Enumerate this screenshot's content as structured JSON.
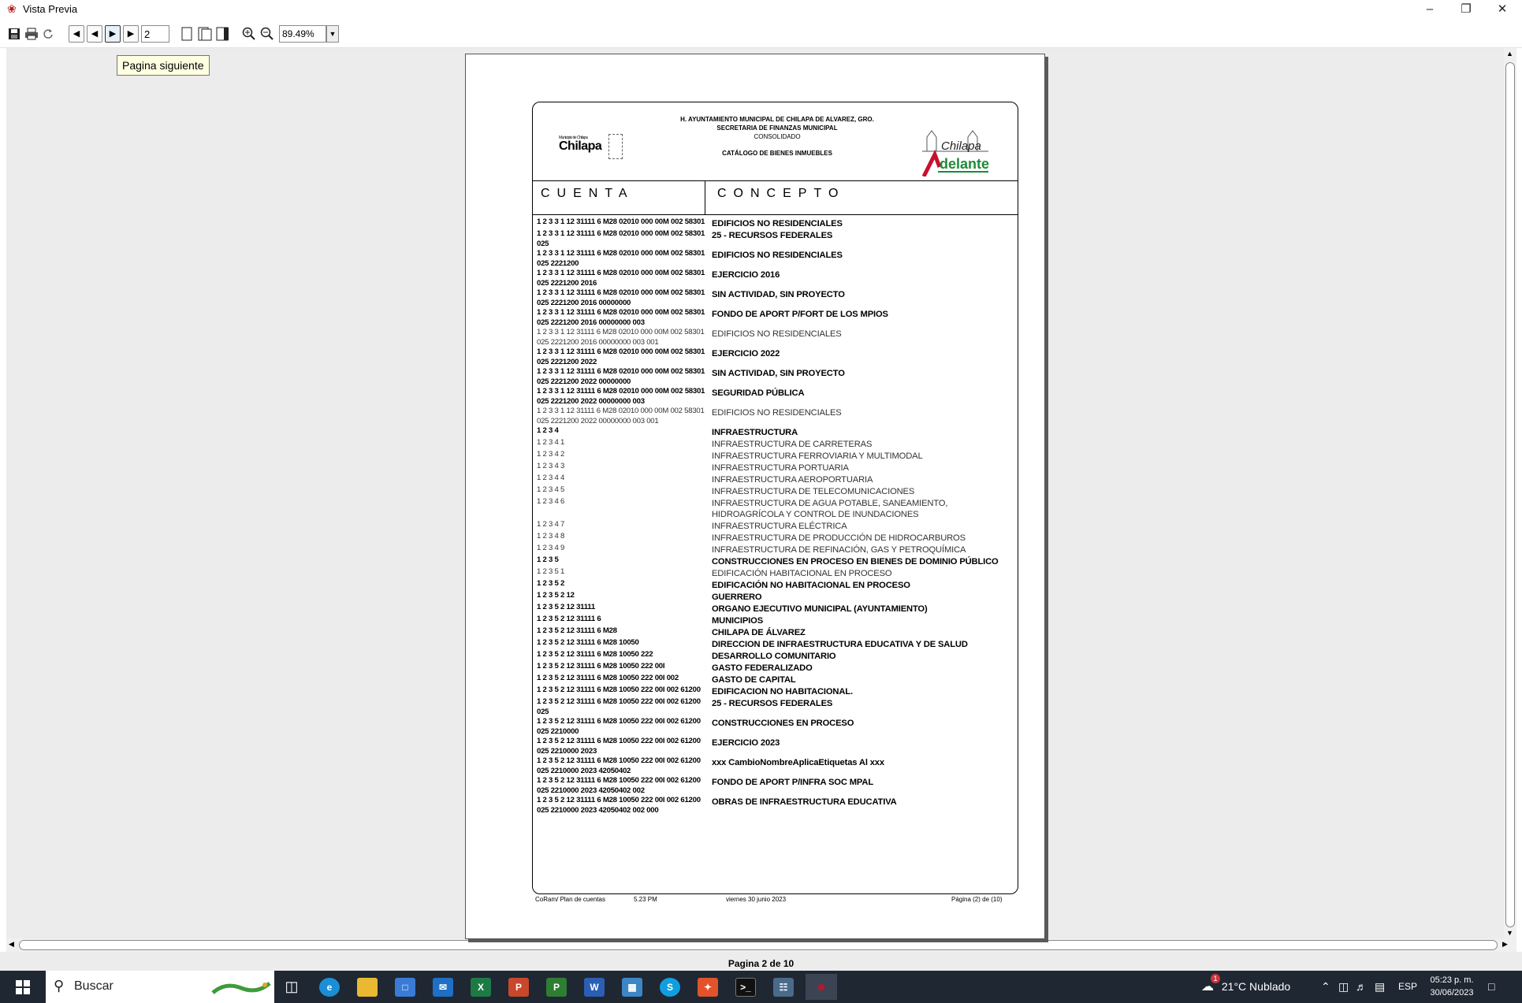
{
  "window": {
    "title": "Vista Previa",
    "minimize": "–",
    "restore": "❐",
    "close": "✕"
  },
  "toolbar": {
    "page_value": "2",
    "zoom_value": "89.49%",
    "tooltip": "Pagina siguiente",
    "icons": [
      "save-icon",
      "print-icon",
      "refresh-icon",
      "first-page-icon",
      "previous-page-icon",
      "next-page-icon",
      "last-page-icon",
      "single-page-icon",
      "two-page-icon",
      "multi-page-icon",
      "zoom-in-icon",
      "zoom-out-icon"
    ]
  },
  "status": {
    "page_of": "Pagina 2 de 10"
  },
  "report": {
    "org": "H. AYUNTAMIENTO MUNICIPAL DE CHILAPA DE ALVAREZ, GRO.",
    "dept": "SECRETARIA DE FINANZAS MUNICIPAL",
    "scope": "CONSOLIDADO",
    "title": "CATÁLOGO DE BIENES INMUEBLES",
    "logo_left": "Chilapa",
    "logo_left_small": "Municipio de Chilapa",
    "logo_right_top": "Chilapa",
    "logo_right_bottom": "delante",
    "col_cuenta": "CUENTA",
    "col_concepto": "CONCEPTO",
    "rows": [
      {
        "cuenta": "1 2 3 3 1 12 31111 6 M28 02010 000 00M 002 58301",
        "concepto": "EDIFICIOS NO RESIDENCIALES",
        "bold": true
      },
      {
        "cuenta": "1 2 3 3 1 12 31111 6 M28 02010 000 00M 002 58301 025",
        "concepto": "25 - RECURSOS FEDERALES",
        "bold": true
      },
      {
        "cuenta": "1 2 3 3 1 12 31111 6 M28 02010 000 00M 002 58301 025 2221200",
        "concepto": "EDIFICIOS NO RESIDENCIALES",
        "bold": true
      },
      {
        "cuenta": "1 2 3 3 1 12 31111 6 M28 02010 000 00M 002 58301 025 2221200 2016",
        "concepto": "EJERCICIO 2016",
        "bold": true
      },
      {
        "cuenta": "1 2 3 3 1 12 31111 6 M28 02010 000 00M 002 58301 025 2221200 2016 00000000",
        "concepto": "SIN ACTIVIDAD, SIN PROYECTO",
        "bold": true
      },
      {
        "cuenta": "1 2 3 3 1 12 31111 6 M28 02010 000 00M 002 58301 025 2221200 2016 00000000 003",
        "concepto": "FONDO DE APORT P/FORT DE LOS MPIOS",
        "bold": true
      },
      {
        "cuenta": "1 2 3 3 1 12 31111 6 M28 02010 000 00M 002 58301 025 2221200 2016 00000000 003 001",
        "concepto": "EDIFICIOS NO RESIDENCIALES",
        "bold": false
      },
      {
        "cuenta": "1 2 3 3 1 12 31111 6 M28 02010 000 00M 002 58301 025 2221200 2022",
        "concepto": "EJERCICIO 2022",
        "bold": true
      },
      {
        "cuenta": "1 2 3 3 1 12 31111 6 M28 02010 000 00M 002 58301 025 2221200 2022 00000000",
        "concepto": "SIN ACTIVIDAD, SIN PROYECTO",
        "bold": true
      },
      {
        "cuenta": "1 2 3 3 1 12 31111 6 M28 02010 000 00M 002 58301 025 2221200 2022 00000000 003",
        "concepto": "SEGURIDAD PÚBLICA",
        "bold": true
      },
      {
        "cuenta": "1 2 3 3 1 12 31111 6 M28 02010 000 00M 002 58301 025 2221200 2022 00000000 003 001",
        "concepto": "EDIFICIOS NO RESIDENCIALES",
        "bold": false
      },
      {
        "cuenta": "1 2 3 4",
        "concepto": "INFRAESTRUCTURA",
        "bold": true
      },
      {
        "cuenta": "1 2 3 4 1",
        "concepto": "INFRAESTRUCTURA DE CARRETERAS",
        "bold": false
      },
      {
        "cuenta": "1 2 3 4 2",
        "concepto": "INFRAESTRUCTURA FERROVIARIA Y MULTIMODAL",
        "bold": false
      },
      {
        "cuenta": "1 2 3 4 3",
        "concepto": "INFRAESTRUCTURA PORTUARIA",
        "bold": false
      },
      {
        "cuenta": "1 2 3 4 4",
        "concepto": "INFRAESTRUCTURA AEROPORTUARIA",
        "bold": false
      },
      {
        "cuenta": "1 2 3 4 5",
        "concepto": "INFRAESTRUCTURA DE TELECOMUNICACIONES",
        "bold": false
      },
      {
        "cuenta": "1 2 3 4 6",
        "concepto": "INFRAESTRUCTURA DE AGUA POTABLE, SANEAMIENTO, HIDROAGRÍCOLA Y CONTROL DE INUNDACIONES",
        "bold": false
      },
      {
        "cuenta": "1 2 3 4 7",
        "concepto": "INFRAESTRUCTURA ELÉCTRICA",
        "bold": false
      },
      {
        "cuenta": "1 2 3 4 8",
        "concepto": "INFRAESTRUCTURA DE PRODUCCIÓN DE HIDROCARBUROS",
        "bold": false
      },
      {
        "cuenta": "1 2 3 4 9",
        "concepto": "INFRAESTRUCTURA DE REFINACIÓN, GAS Y PETROQUÍMICA",
        "bold": false
      },
      {
        "cuenta": "1 2 3 5",
        "concepto": "CONSTRUCCIONES EN PROCESO EN BIENES DE DOMINIO PÚBLICO",
        "bold": true
      },
      {
        "cuenta": "1 2 3 5 1",
        "concepto": "EDIFICACIÓN HABITACIONAL EN PROCESO",
        "bold": false
      },
      {
        "cuenta": "1 2 3 5 2",
        "concepto": "EDIFICACIÓN NO HABITACIONAL EN PROCESO",
        "bold": true
      },
      {
        "cuenta": "1 2 3 5 2 12",
        "concepto": "GUERRERO",
        "bold": true
      },
      {
        "cuenta": "1 2 3 5 2 12 31111",
        "concepto": "ORGANO EJECUTIVO MUNICIPAL (AYUNTAMIENTO)",
        "bold": true
      },
      {
        "cuenta": "1 2 3 5 2 12 31111 6",
        "concepto": "MUNICIPIOS",
        "bold": true
      },
      {
        "cuenta": "1 2 3 5 2 12 31111 6 M28",
        "concepto": "CHILAPA DE ÁLVAREZ",
        "bold": true
      },
      {
        "cuenta": "1 2 3 5 2 12 31111 6 M28 10050",
        "concepto": "DIRECCION DE INFRAESTRUCTURA EDUCATIVA Y DE SALUD",
        "bold": true
      },
      {
        "cuenta": "1 2 3 5 2 12 31111 6 M28 10050 222",
        "concepto": "DESARROLLO COMUNITARIO",
        "bold": true
      },
      {
        "cuenta": "1 2 3 5 2 12 31111 6 M28 10050 222 00I",
        "concepto": "GASTO FEDERALIZADO",
        "bold": true
      },
      {
        "cuenta": "1 2 3 5 2 12 31111 6 M28 10050 222 00I 002",
        "concepto": "GASTO DE CAPITAL",
        "bold": true
      },
      {
        "cuenta": "1 2 3 5 2 12 31111 6 M28 10050 222 00I 002 61200",
        "concepto": "EDIFICACION NO HABITACIONAL.",
        "bold": true
      },
      {
        "cuenta": "1 2 3 5 2 12 31111 6 M28 10050 222 00I 002 61200 025",
        "concepto": "25 - RECURSOS FEDERALES",
        "bold": true
      },
      {
        "cuenta": "1 2 3 5 2 12 31111 6 M28 10050 222 00I 002 61200 025 2210000",
        "concepto": "CONSTRUCCIONES EN PROCESO",
        "bold": true
      },
      {
        "cuenta": "1 2 3 5 2 12 31111 6 M28 10050 222 00I 002 61200 025 2210000 2023",
        "concepto": "EJERCICIO 2023",
        "bold": true
      },
      {
        "cuenta": "1 2 3 5 2 12 31111 6 M28 10050 222 00I 002 61200 025 2210000 2023 42050402",
        "concepto": "xxx CambioNombreAplicaEtiquetas Al xxx",
        "bold": true
      },
      {
        "cuenta": "1 2 3 5 2 12 31111 6 M28 10050 222 00I 002 61200 025 2210000 2023 42050402 002",
        "concepto": "FONDO DE APORT P/INFRA SOC MPAL",
        "bold": true
      },
      {
        "cuenta": "1 2 3 5 2 12 31111 6 M28 10050 222 00I 002 61200 025 2210000 2023 42050402 002 000",
        "concepto": "OBRAS DE INFRAESTRUCTURA EDUCATIVA",
        "bold": true
      }
    ],
    "footer": {
      "source": "CoRam/ Plan de cuentas",
      "time": "5.23 PM",
      "date": "viernes 30 junio 2023",
      "page": "Página (2) de (10)"
    }
  },
  "taskbar": {
    "search_placeholder": "Buscar",
    "weather": "21°C  Nublado",
    "lang": "ESP",
    "time": "05:23 p. m.",
    "date": "30/06/2023",
    "notification_badge": "1"
  },
  "colors": {
    "accent_red": "#c8102e",
    "accent_green": "#1e8a3a",
    "taskbar": "#1f2733"
  }
}
